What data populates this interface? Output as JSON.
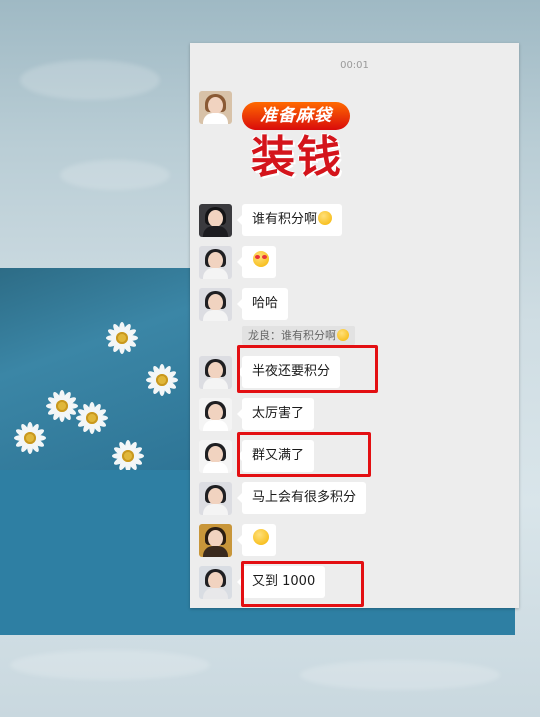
{
  "chat": {
    "timestamp": "00:01",
    "sticker": {
      "line1": "准备麻袋",
      "line2": "装钱"
    },
    "messages": [
      {
        "text": "谁有积分啊",
        "emoji": "sweat-smile-emoji"
      },
      {
        "text": "",
        "emoji": "heart-eyes-emoji"
      },
      {
        "text": "哈哈"
      },
      {
        "text": "半夜还要积分",
        "highlighted": true
      },
      {
        "text": "太厉害了"
      },
      {
        "text": "群又满了",
        "highlighted": true
      },
      {
        "text": "马上会有很多积分"
      },
      {
        "text": "",
        "emoji": "thinking-emoji"
      },
      {
        "text": "又到 1000",
        "highlighted": true
      }
    ],
    "quote": {
      "text": "龙良：谁有积分啊"
    },
    "highlight_color": "#e30f12"
  }
}
